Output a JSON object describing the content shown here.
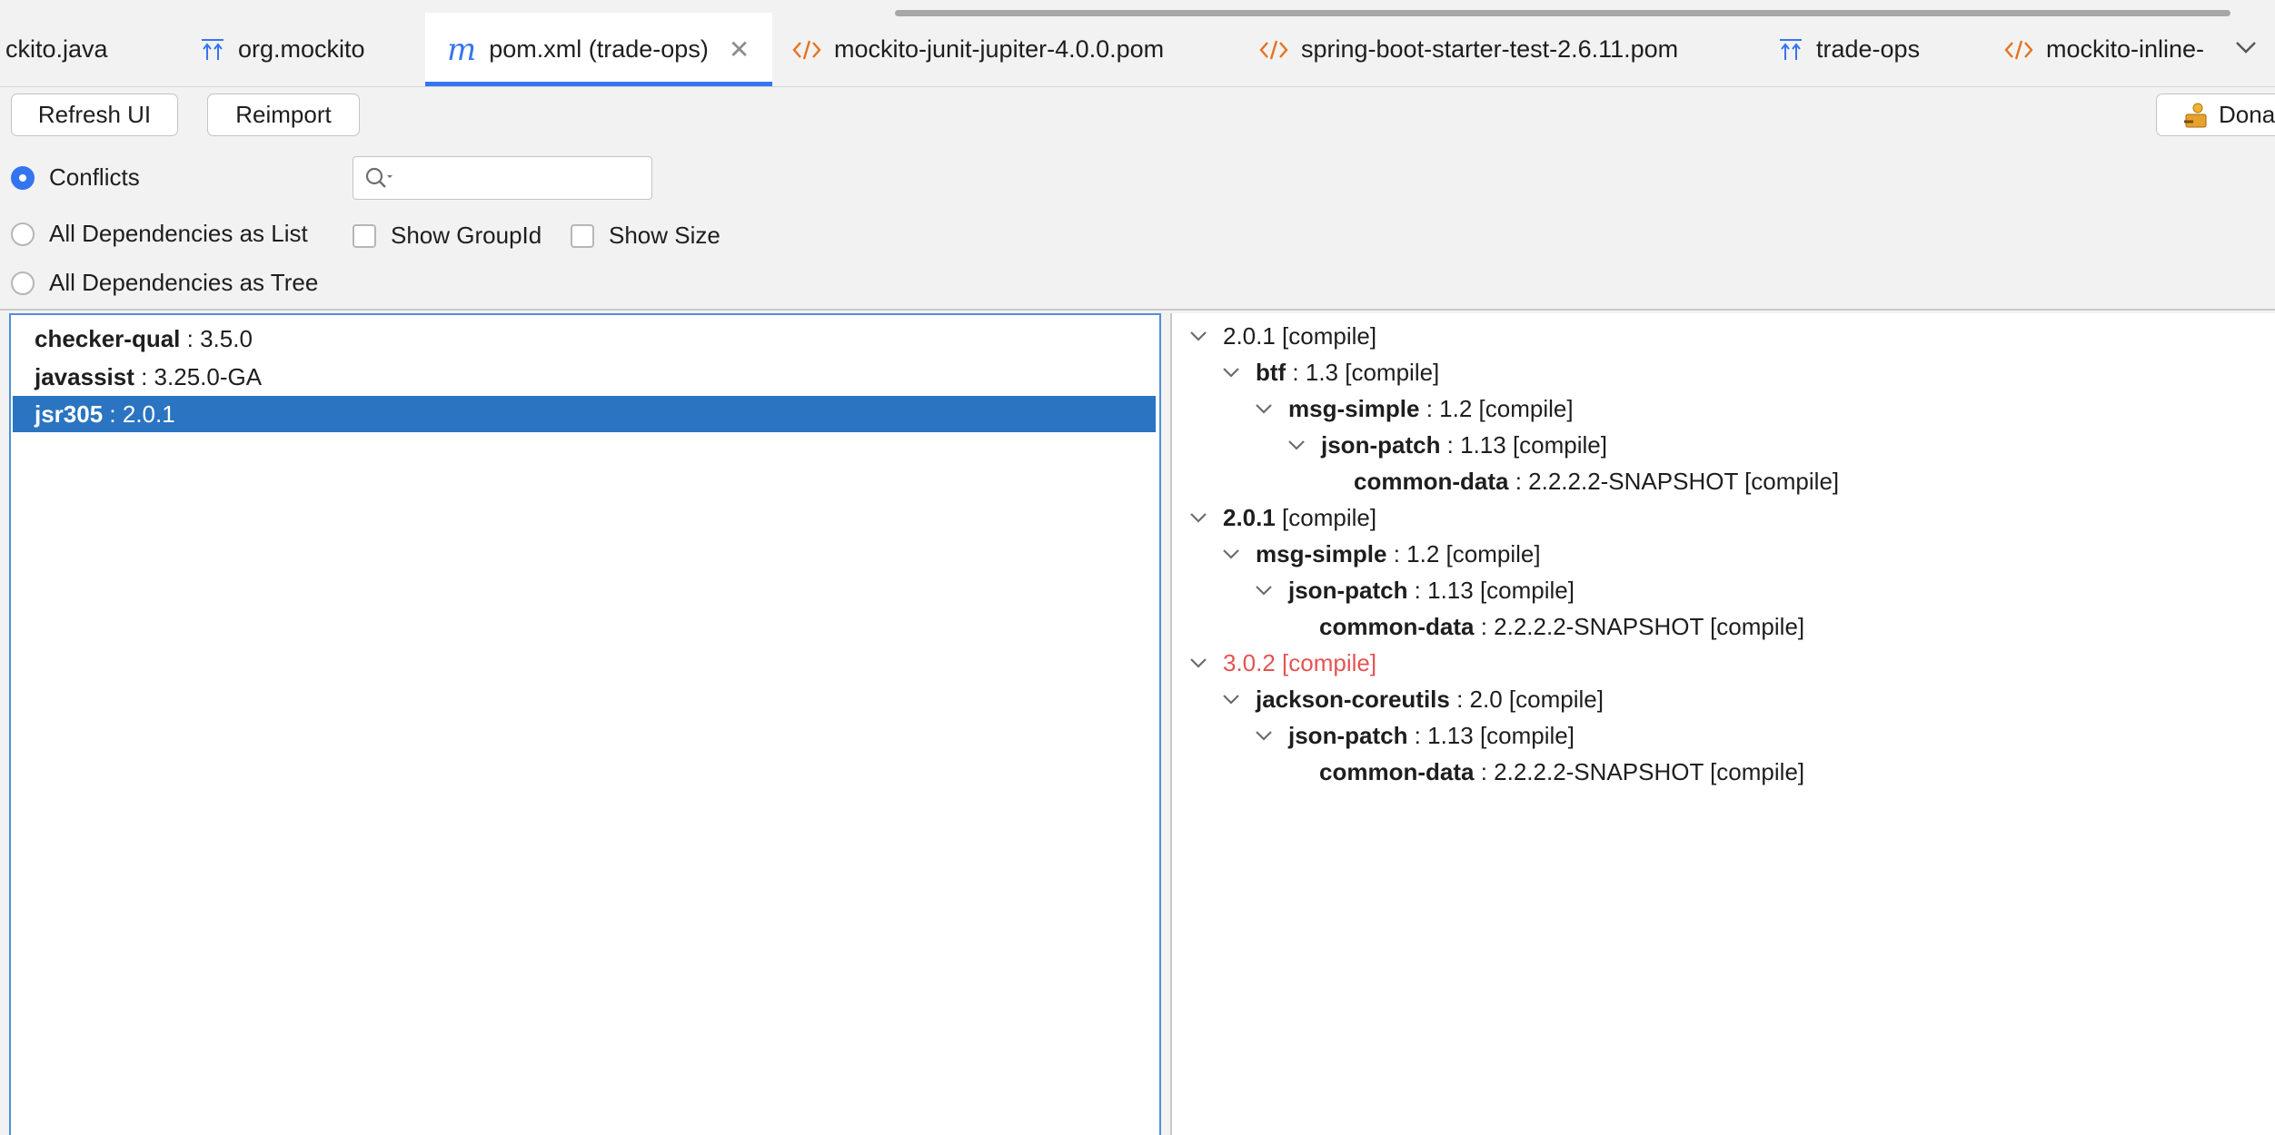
{
  "tabs": [
    {
      "label": "ckito.java",
      "icon": "java-file-icon",
      "active": false
    },
    {
      "label": "org.mockito",
      "icon": "module-icon",
      "active": false
    },
    {
      "label": "pom.xml (trade-ops)",
      "icon": "maven-icon",
      "active": true,
      "closable": true
    },
    {
      "label": "mockito-junit-jupiter-4.0.0.pom",
      "icon": "xml-file-icon",
      "active": false
    },
    {
      "label": "spring-boot-starter-test-2.6.11.pom",
      "icon": "xml-file-icon",
      "active": false
    },
    {
      "label": "trade-ops",
      "icon": "module-icon",
      "active": false
    },
    {
      "label": "mockito-inline-",
      "icon": "xml-file-icon",
      "active": false
    }
  ],
  "toolbar": {
    "refresh_label": "Refresh UI",
    "reimport_label": "Reimport",
    "donate_label": "Dona"
  },
  "view_options": {
    "conflicts_label": "Conflicts",
    "list_label": "All Dependencies as List",
    "tree_label": "All Dependencies as Tree",
    "selected": "Conflicts"
  },
  "search": {
    "placeholder": "",
    "value": ""
  },
  "filters": {
    "show_groupid_label": "Show GroupId",
    "show_groupid_checked": false,
    "show_size_label": "Show Size",
    "show_size_checked": false
  },
  "dependencies": [
    {
      "name": "checker-qual",
      "version": " : 3.5.0",
      "selected": false
    },
    {
      "name": "javassist",
      "version": " : 3.25.0-GA",
      "selected": false
    },
    {
      "name": "jsr305",
      "version": " : 2.0.1",
      "selected": true
    }
  ],
  "tree": [
    {
      "depth": 0,
      "expandable": true,
      "name": "",
      "rest": "2.0.1 [compile]",
      "conflict": false
    },
    {
      "depth": 1,
      "expandable": true,
      "name": "btf",
      "rest": " : 1.3 [compile]",
      "conflict": false
    },
    {
      "depth": 2,
      "expandable": true,
      "name": "msg-simple",
      "rest": " : 1.2 [compile]",
      "conflict": false
    },
    {
      "depth": 3,
      "expandable": true,
      "name": "json-patch",
      "rest": " : 1.13 [compile]",
      "conflict": false
    },
    {
      "depth": 4,
      "expandable": false,
      "name": "common-data",
      "rest": " : 2.2.2.2-SNAPSHOT [compile]",
      "conflict": false
    },
    {
      "depth": 0,
      "expandable": true,
      "name": "2.0.1",
      "rest": " [compile]",
      "conflict": false
    },
    {
      "depth": 1,
      "expandable": true,
      "name": "msg-simple",
      "rest": " : 1.2 [compile]",
      "conflict": false
    },
    {
      "depth": 2,
      "expandable": true,
      "name": "json-patch",
      "rest": " : 1.13 [compile]",
      "conflict": false
    },
    {
      "depth": 3,
      "expandable": false,
      "name": "common-data",
      "rest": " : 2.2.2.2-SNAPSHOT [compile]",
      "conflict": false
    },
    {
      "depth": 0,
      "expandable": true,
      "name": "",
      "rest": "3.0.2 [compile]",
      "conflict": true
    },
    {
      "depth": 1,
      "expandable": true,
      "name": "jackson-coreutils",
      "rest": " : 2.0 [compile]",
      "conflict": false
    },
    {
      "depth": 2,
      "expandable": true,
      "name": "json-patch",
      "rest": " : 1.13 [compile]",
      "conflict": false
    },
    {
      "depth": 3,
      "expandable": false,
      "name": "common-data",
      "rest": " : 2.2.2.2-SNAPSHOT [compile]",
      "conflict": false
    }
  ],
  "colors": {
    "accent": "#3574f0",
    "selection": "#2a74c2",
    "conflict": "#e55353",
    "xml_icon": "#e8711c"
  }
}
